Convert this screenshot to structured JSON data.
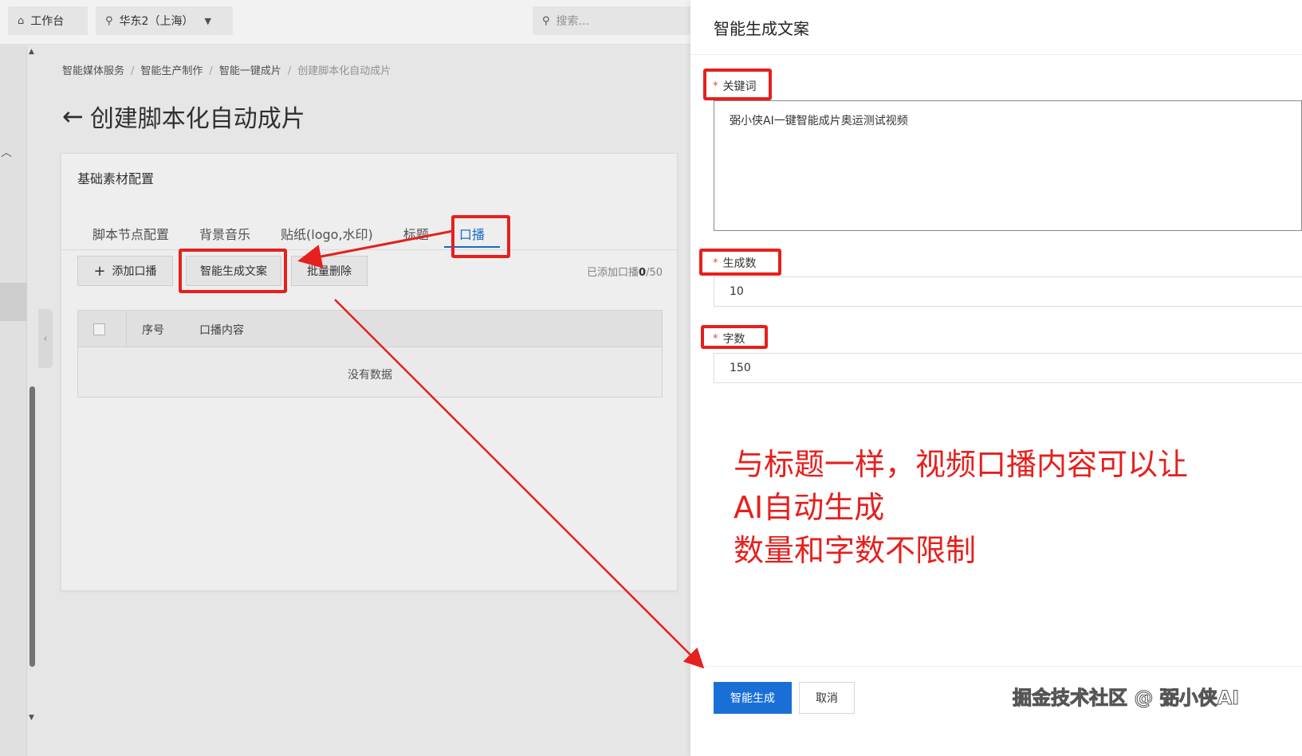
{
  "topbar": {
    "workbench_label": "工作台",
    "region_label": "华东2（上海）",
    "search_placeholder": "搜索..."
  },
  "breadcrumb": [
    "智能媒体服务",
    "智能生产制作",
    "智能一键成片",
    "创建脚本化自动成片"
  ],
  "page": {
    "title": "创建脚本化自动成片"
  },
  "card": {
    "title": "基础素材配置",
    "tabs": [
      "脚本节点配置",
      "背景音乐",
      "贴纸(logo,水印)",
      "标题",
      "口播"
    ],
    "active_tab": "口播",
    "toolbar": {
      "add_label": "添加口播",
      "generate_label": "智能生成文案",
      "batch_delete_label": "批量删除",
      "added_prefix": "已添加口播",
      "added_value": "0",
      "added_suffix": "/50"
    },
    "table": {
      "columns": [
        "序号",
        "口播内容"
      ],
      "empty_text": "没有数据"
    }
  },
  "drawer": {
    "title": "智能生成文案",
    "keyword_label": "关键词",
    "keyword_value": "弼小侠AI一键智能成片奥运测试视频",
    "count_label": "生成数",
    "count_value": "10",
    "words_label": "字数",
    "words_value": "150",
    "generate_button": "智能生成",
    "cancel_button": "取消"
  },
  "annotation": {
    "line1": "与标题一样，视频口播内容可以让",
    "line2": "AI自动生成",
    "line3": "数量和字数不限制",
    "color": "#e5201d"
  },
  "watermark": "掘金技术社区 @ 弼小侠AI",
  "colors": {
    "primary": "#1a6fd6",
    "highlight": "#e5201d"
  }
}
